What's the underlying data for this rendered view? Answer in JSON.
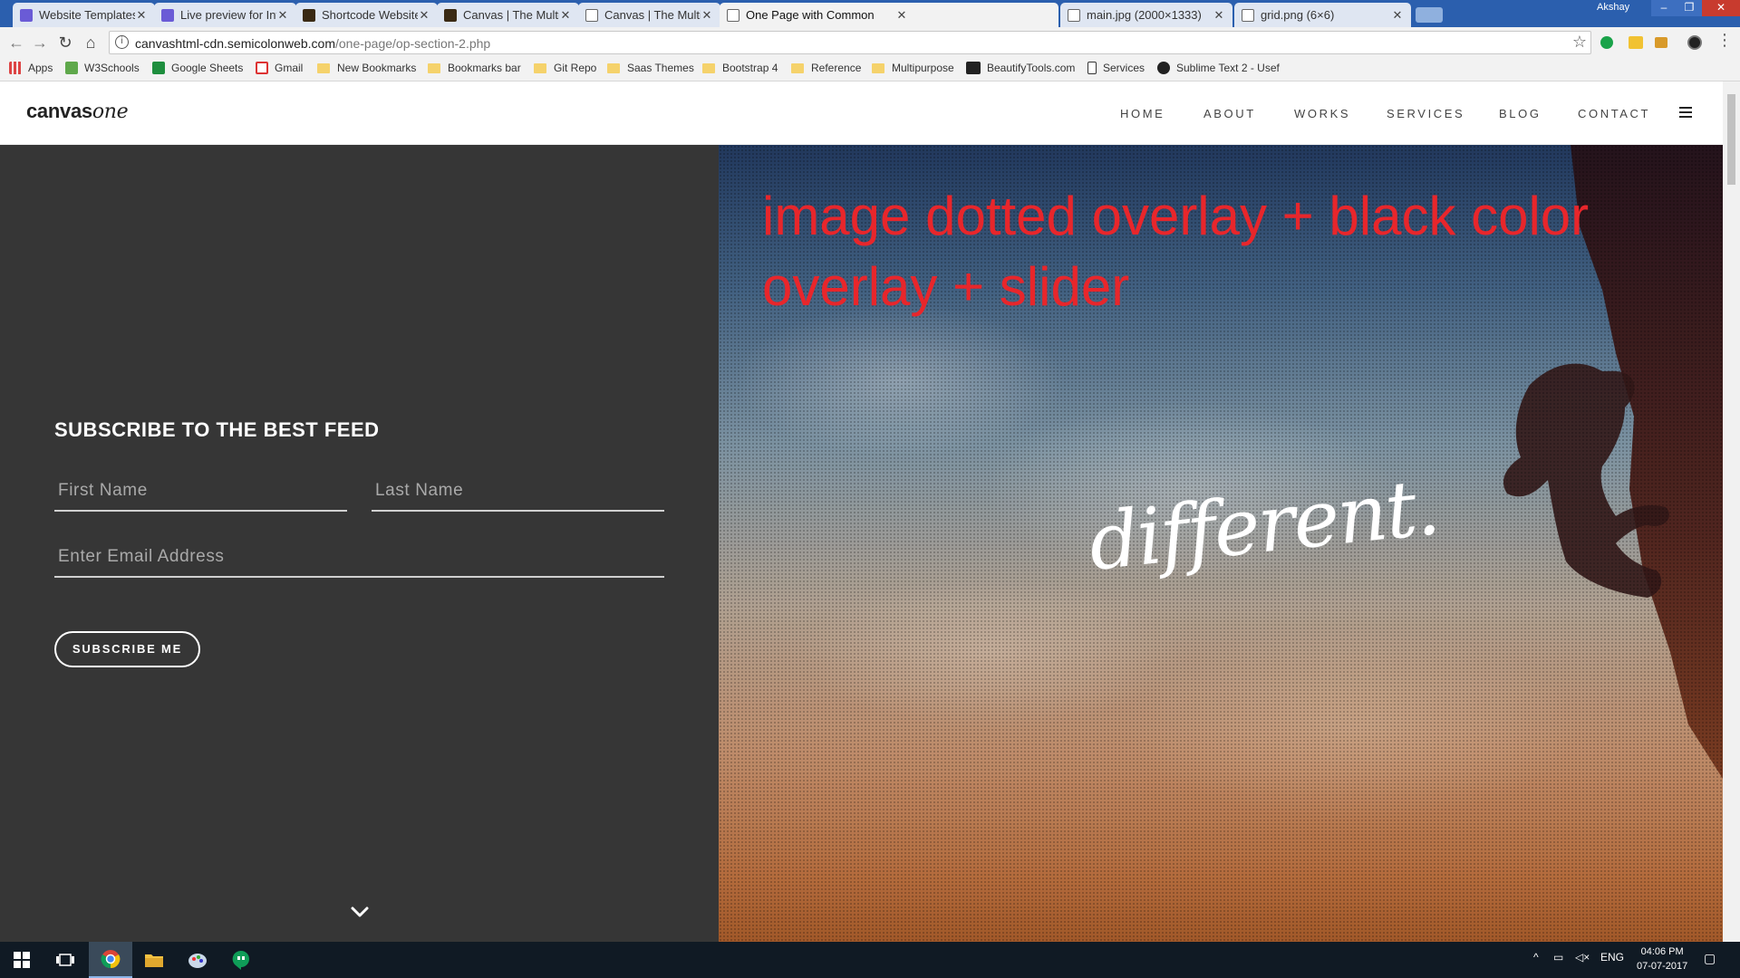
{
  "browser": {
    "tabs": [
      {
        "title": "Website Templates | Web",
        "favicon_color": "#6a5bd6"
      },
      {
        "title": "Live preview for Intense",
        "favicon_color": "#6a5bd6"
      },
      {
        "title": "Shortcode Website Temp",
        "favicon_color": "#3a2a14"
      },
      {
        "title": "Canvas | The Multi-Purpo",
        "favicon_color": "#3a2a14"
      },
      {
        "title": "Canvas | The Multi-Purpo",
        "favicon_color": "#ffffff"
      },
      {
        "title": "One Page with Common",
        "favicon_color": "#ffffff"
      },
      {
        "title": "main.jpg (2000×1333)",
        "favicon_color": "#ffffff"
      },
      {
        "title": "grid.png (6×6)",
        "favicon_color": "#ffffff"
      }
    ],
    "active_tab_index": 5,
    "profile_name": "Akshay",
    "url_host": "canvashtml-cdn.semicolonweb.com",
    "url_path": "/one-page/op-section-2.php",
    "bookmarks": [
      {
        "label": "Apps",
        "icon": "apps-grid-icon"
      },
      {
        "label": "W3Schools",
        "icon": "w3schools-icon"
      },
      {
        "label": "Google Sheets",
        "icon": "sheets-icon"
      },
      {
        "label": "Gmail",
        "icon": "gmail-icon"
      },
      {
        "label": "New Bookmarks",
        "icon": "folder-icon"
      },
      {
        "label": "Bookmarks bar",
        "icon": "folder-icon"
      },
      {
        "label": "Git Repo",
        "icon": "folder-icon"
      },
      {
        "label": "Saas Themes",
        "icon": "folder-icon"
      },
      {
        "label": "Bootstrap 4",
        "icon": "folder-icon"
      },
      {
        "label": "Reference",
        "icon": "folder-icon"
      },
      {
        "label": "Multipurpose",
        "icon": "folder-icon"
      },
      {
        "label": "BeautifyTools.com",
        "icon": "beautifytools-icon"
      },
      {
        "label": "Services",
        "icon": "tumblr-icon"
      },
      {
        "label": "Sublime Text 2 - Usef",
        "icon": "github-icon"
      }
    ]
  },
  "site": {
    "logo_bold": "canvas",
    "logo_italic": "one",
    "nav": [
      "HOME",
      "ABOUT",
      "WORKS",
      "SERVICES",
      "BLOG",
      "CONTACT"
    ],
    "subscribe": {
      "title": "SUBSCRIBE TO THE BEST FEED",
      "first_name_placeholder": "First Name",
      "last_name_placeholder": "Last Name",
      "email_placeholder": "Enter Email Address",
      "button_label": "SUBSCRIBE ME"
    },
    "hero": {
      "annotation": "image dotted overlay + black color overlay + slider",
      "script_word": "different."
    }
  },
  "taskbar": {
    "language": "ENG",
    "time": "04:06 PM",
    "date": "07-07-2017"
  },
  "colors": {
    "tab_strip": "#2b5fae",
    "left_panel": "#363636",
    "annotation_red": "#e8262b"
  }
}
